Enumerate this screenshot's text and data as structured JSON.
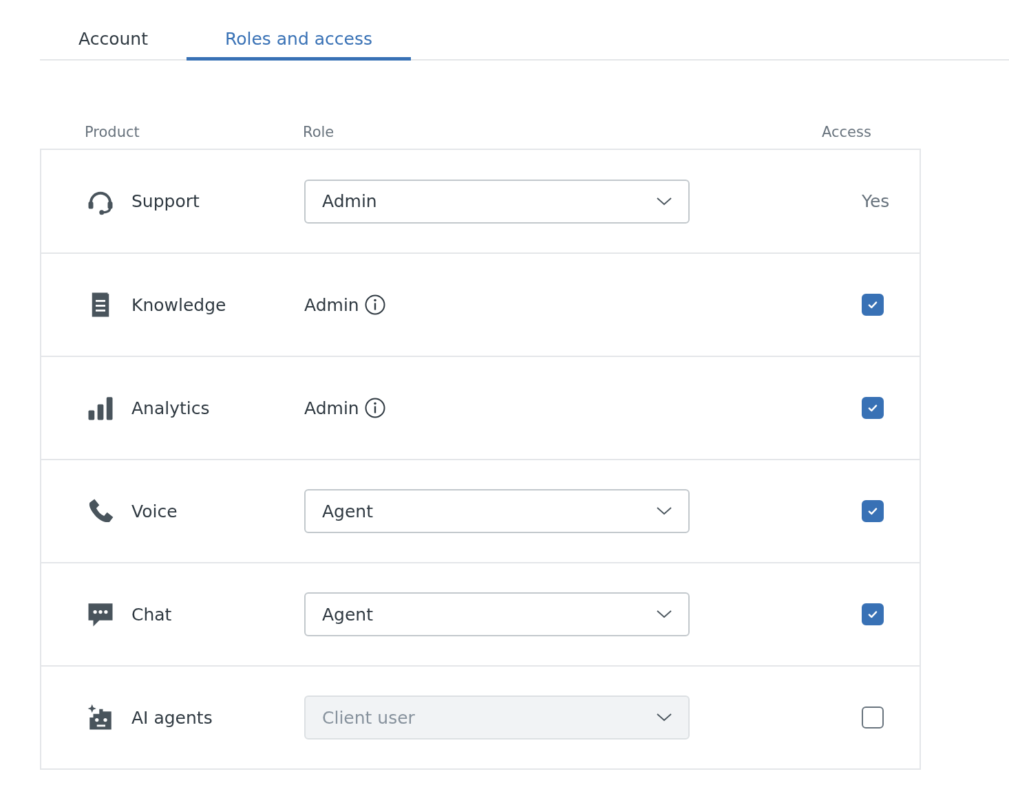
{
  "tabs": [
    {
      "label": "Account",
      "selected": false
    },
    {
      "label": "Roles and access",
      "selected": true
    }
  ],
  "table": {
    "columns": [
      "Product",
      "Role",
      "Access"
    ],
    "rows": [
      {
        "product": "Support",
        "role": {
          "kind": "select",
          "value": "Admin",
          "disabled": false
        },
        "access": {
          "kind": "text",
          "text": "Yes"
        }
      },
      {
        "product": "Knowledge",
        "role": {
          "kind": "info",
          "value": "Admin"
        },
        "access": {
          "kind": "checkbox",
          "checked": true
        }
      },
      {
        "product": "Analytics",
        "role": {
          "kind": "info",
          "value": "Admin"
        },
        "access": {
          "kind": "checkbox",
          "checked": true
        }
      },
      {
        "product": "Voice",
        "role": {
          "kind": "select",
          "value": "Agent",
          "disabled": false
        },
        "access": {
          "kind": "checkbox",
          "checked": true
        }
      },
      {
        "product": "Chat",
        "role": {
          "kind": "select",
          "value": "Agent",
          "disabled": false
        },
        "access": {
          "kind": "checkbox",
          "checked": true
        }
      },
      {
        "product": "AI agents",
        "role": {
          "kind": "select",
          "value": "Client user",
          "disabled": true
        },
        "access": {
          "kind": "checkbox",
          "checked": false
        }
      }
    ]
  }
}
